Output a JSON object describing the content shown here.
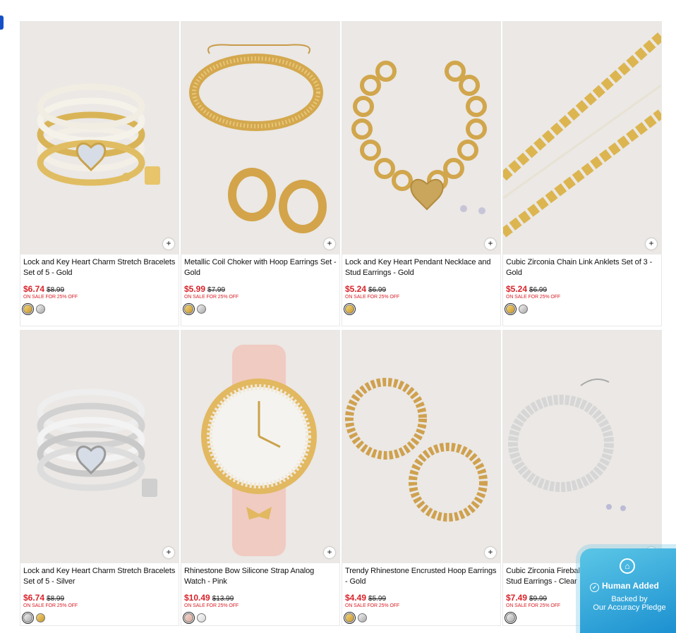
{
  "quick_add_symbol": "+",
  "products": [
    {
      "title": "Lock and Key Heart Charm Stretch Bracelets Set of 5 - Gold",
      "sale_price": "$6.74",
      "original_price": "$8.99",
      "promo": "ON SALE FOR 25% OFF",
      "swatches": [
        "gold",
        "silver"
      ],
      "image": "bracelets-gold"
    },
    {
      "title": "Metallic Coil Choker with Hoop Earrings Set - Gold",
      "sale_price": "$5.99",
      "original_price": "$7.99",
      "promo": "ON SALE FOR 25% OFF",
      "swatches": [
        "gold",
        "silver"
      ],
      "image": "coil-choker"
    },
    {
      "title": "Lock and Key Heart Pendant Necklace and Stud Earrings - Gold",
      "sale_price": "$5.24",
      "original_price": "$6.99",
      "promo": "ON SALE FOR 25% OFF",
      "swatches": [
        "gold"
      ],
      "image": "chain-heart"
    },
    {
      "title": "Cubic Zirconia Chain Link Anklets Set of 3 - Gold",
      "sale_price": "$5.24",
      "original_price": "$6.99",
      "promo": "ON SALE FOR 25% OFF",
      "swatches": [
        "gold",
        "silver"
      ],
      "image": "anklets"
    },
    {
      "title": "Lock and Key Heart Charm Stretch Bracelets Set of 5 - Silver",
      "sale_price": "$6.74",
      "original_price": "$8.99",
      "promo": "ON SALE FOR 25% OFF",
      "swatches": [
        "silver",
        "gold"
      ],
      "image": "bracelets-silver"
    },
    {
      "title": "Rhinestone Bow Silicone Strap Analog Watch - Pink",
      "sale_price": "$10.49",
      "original_price": "$13.99",
      "promo": "ON SALE FOR 25% OFF",
      "swatches": [
        "pink",
        "clear"
      ],
      "image": "watch"
    },
    {
      "title": "Trendy Rhinestone Encrusted Hoop Earrings - Gold",
      "sale_price": "$4.49",
      "original_price": "$5.99",
      "promo": "ON SALE FOR 25% OFF",
      "swatches": [
        "gold",
        "silver"
      ],
      "image": "hoops"
    },
    {
      "title": "Cubic Zirconia Fireball Beaded Necklace and Stud Earrings - Clear",
      "sale_price": "$7.49",
      "original_price": "$9.99",
      "promo": "ON SALE FOR 25% OFF",
      "swatches": [
        "silver"
      ],
      "image": "fireball"
    }
  ],
  "badge": {
    "line1": "Human Added",
    "line2": "Backed by",
    "line3": "Our Accuracy Pledge",
    "icon": "home-icon"
  },
  "colors": {
    "sale": "#d8232a",
    "badge": "#1a8fd0",
    "accent": "#1650c8"
  }
}
